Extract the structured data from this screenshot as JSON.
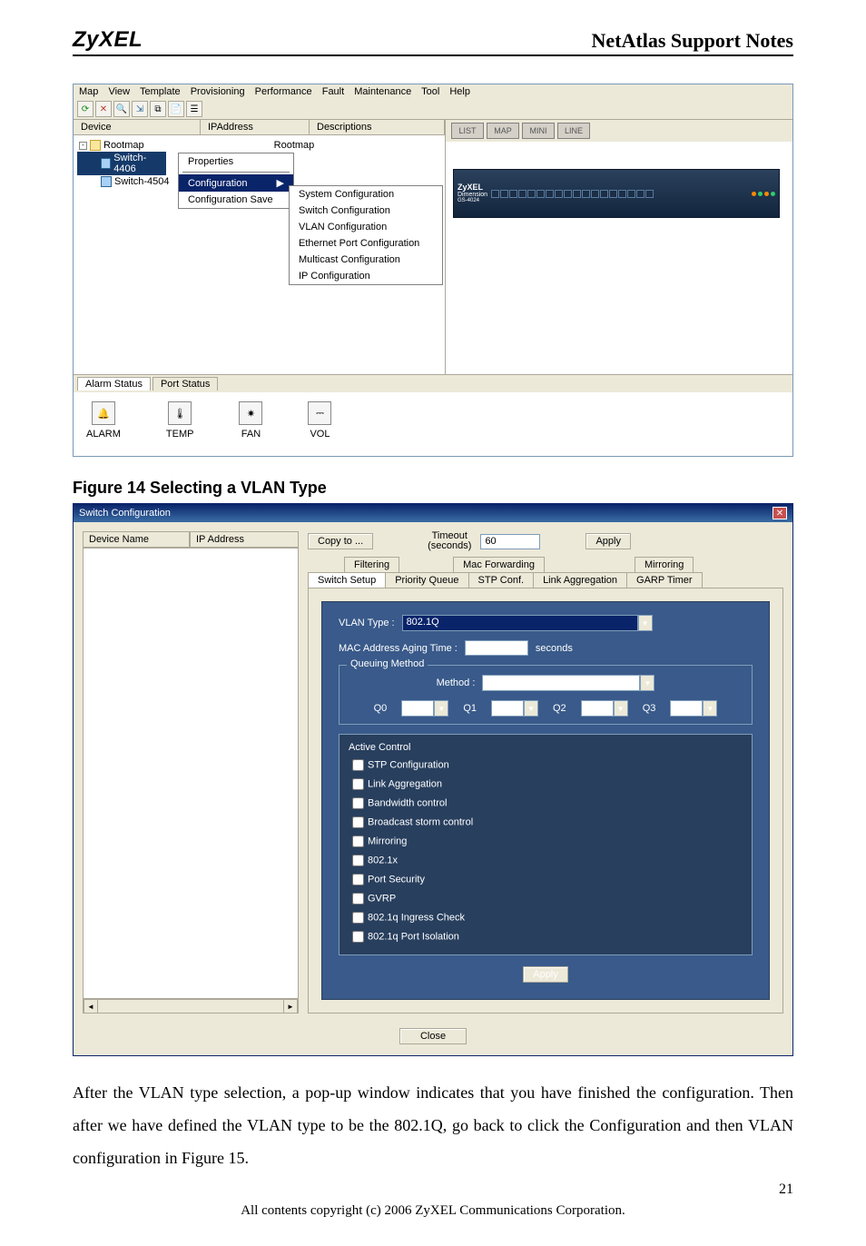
{
  "header": {
    "logo": "ZyXEL",
    "title": "NetAtlas Support Notes"
  },
  "screenshot1": {
    "menus": [
      "Map",
      "View",
      "Template",
      "Provisioning",
      "Performance",
      "Fault",
      "Maintenance",
      "Tool",
      "Help"
    ],
    "list_headers": {
      "device": "Device",
      "ip": "IPAddress",
      "desc": "Descriptions"
    },
    "tree": {
      "root": "Rootmap",
      "root_desc": "Rootmap",
      "children": [
        "Switch-4406",
        "Switch-4504"
      ]
    },
    "context_menu": {
      "items": [
        "Properties",
        "Configuration",
        "Configuration Save"
      ],
      "highlighted": "Configuration",
      "arrow_index": 1
    },
    "sub_menu": [
      "System Configuration",
      "Switch Configuration",
      "VLAN Configuration",
      "Ethernet Port Configuration",
      "Multicast Configuration",
      "IP Configuration"
    ],
    "right_buttons": [
      "LIST",
      "MAP",
      "MINI",
      "LINE"
    ],
    "rack": {
      "brand": "ZyXEL",
      "model": "Dimension",
      "subtitle": "GS-4024"
    },
    "status_tabs": [
      "Alarm Status",
      "Port Status"
    ],
    "status_cells": [
      "ALARM",
      "TEMP",
      "FAN",
      "VOL"
    ]
  },
  "caption": "Figure 14 Selecting a VLAN Type",
  "screenshot2": {
    "title": "Switch Configuration",
    "left_headers": {
      "device": "Device Name",
      "ip": "IP Address"
    },
    "copy_to": "Copy to ...",
    "timeout": {
      "label1": "Timeout",
      "label2": "(seconds)",
      "value": "60"
    },
    "apply": "Apply",
    "tabs_row1": [
      "Filtering",
      "Mac Forwarding",
      "Mirroring"
    ],
    "tabs_row2": [
      "Switch Setup",
      "Priority Queue",
      "STP Conf.",
      "Link Aggregation",
      "GARP Timer"
    ],
    "vlan": {
      "label": "VLAN Type :",
      "value": "802.1Q"
    },
    "mac_label": "MAC Address Aging Time :",
    "mac_unit": "seconds",
    "queuing_legend": "Queuing Method",
    "method_label": "Method :",
    "queues": [
      "Q0",
      "Q1",
      "Q2",
      "Q3"
    ],
    "active_header": "Active Control",
    "active_items": [
      "STP Configuration",
      "Link Aggregation",
      "Bandwidth control",
      "Broadcast storm control",
      "Mirroring",
      "802.1x",
      "Port Security",
      "GVRP",
      "802.1q Ingress Check",
      "802.1q Port Isolation"
    ],
    "close": "Close"
  },
  "body_text": "After the VLAN type selection, a pop-up window indicates that you have finished the configuration. Then after we have defined the VLAN type to be the 802.1Q, go back to click the Configuration and then VLAN configuration in Figure 15.",
  "page_number": "21",
  "copyright": "All contents copyright (c) 2006 ZyXEL Communications Corporation."
}
